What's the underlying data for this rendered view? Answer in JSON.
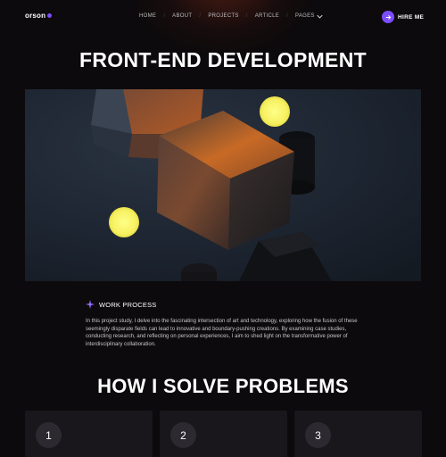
{
  "brand": {
    "logo_text": "orson",
    "accent": "#7c4dff"
  },
  "nav": {
    "items": [
      {
        "label": "HOME"
      },
      {
        "label": "ABOUT"
      },
      {
        "label": "PROJECTS"
      },
      {
        "label": "ARTICLE"
      },
      {
        "label": "PAGES"
      }
    ],
    "separator": "/",
    "hire_label": "HIRE ME"
  },
  "page": {
    "title": "FRONT-END DEVELOPMENT"
  },
  "work_process": {
    "heading": "WORK PROCESS",
    "body": "In this project study, I delve into the fascinating intersection of art and technology, exploring how the fusion of these seemingly disparate fields can lead to innovative and boundary-pushing creations. By examining case studies, conducting research, and reflecting on personal experiences, I aim to shed light on the transformative power of interdisciplinary collaboration."
  },
  "solve": {
    "title": "HOW I SOLVE PROBLEMS",
    "steps": [
      {
        "number": "1"
      },
      {
        "number": "2"
      },
      {
        "number": "3"
      }
    ]
  }
}
